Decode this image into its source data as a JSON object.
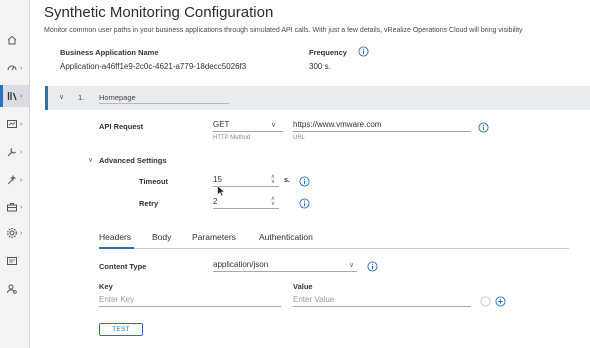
{
  "page": {
    "title": "Synthetic Monitoring Configuration",
    "subtitle": "Monitor common user paths in your business applications through simulated API calls. With just a few details, vRealize Operations Cloud will bring visibility"
  },
  "app_info": {
    "name_label": "Business Application Name",
    "name_value": "Application-a46ff1e9-2c0c-4621-a779-18decc5026f3",
    "frequency_label": "Frequency",
    "frequency_value": "300 s."
  },
  "step": {
    "number": "1.",
    "name": "Homepage"
  },
  "api_request": {
    "label": "API Request",
    "method": "GET",
    "method_hint": "HTTP Method",
    "url": "https://www.vmware.com",
    "url_hint": "URL"
  },
  "advanced": {
    "label": "Advanced Settings",
    "timeout_label": "Timeout",
    "timeout_value": "15",
    "timeout_unit": "s.",
    "retry_label": "Retry",
    "retry_value": "2"
  },
  "tabs": [
    {
      "label": "Headers"
    },
    {
      "label": "Body"
    },
    {
      "label": "Parameters"
    },
    {
      "label": "Authentication"
    }
  ],
  "headers": {
    "content_type_label": "Content Type",
    "content_type_value": "application/json",
    "key_label": "Key",
    "key_placeholder": "Enter Key",
    "value_label": "Value",
    "value_placeholder": "Enter Value"
  },
  "test_button": "TEST",
  "icons": {
    "home": "home-icon",
    "dashboards": "dashboards-icon",
    "library": "library-icon",
    "visualize": "visualize-icon",
    "troubleshoot": "troubleshoot-icon",
    "optimize": "optimize-icon",
    "plan": "plan-icon",
    "configure": "configure-icon",
    "monitor": "monitor-icon",
    "admin": "admin-icon",
    "info": "info-icon",
    "add": "add-circle-icon"
  },
  "colors": {
    "accent": "#2f6fb3",
    "nav_bg": "#f3f3f3",
    "step_bg": "#e8ecf1"
  }
}
